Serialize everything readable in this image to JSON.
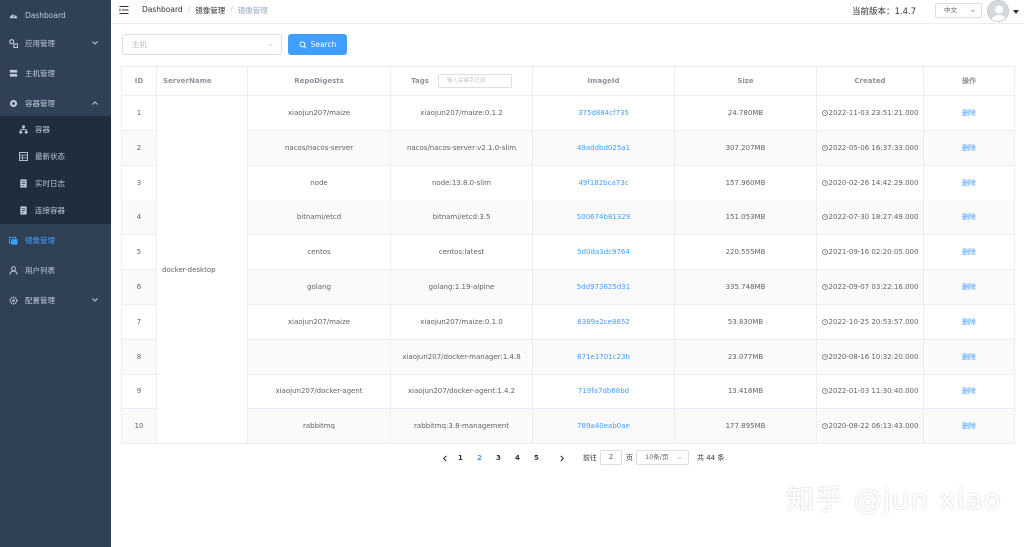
{
  "sidebar": {
    "items": [
      {
        "label": "Dashboard",
        "icon": "dashboard-icon"
      },
      {
        "label": "应用管理",
        "icon": "app-icon"
      },
      {
        "label": "主机管理",
        "icon": "server-icon"
      },
      {
        "label": "容器管理",
        "icon": "container-icon"
      },
      {
        "label": "镜像管理",
        "icon": "image-icon"
      },
      {
        "label": "用户列表",
        "icon": "user-icon"
      },
      {
        "label": "配置管理",
        "icon": "settings-icon"
      }
    ],
    "sub_items": [
      {
        "label": "容器",
        "icon": "tree-icon"
      },
      {
        "label": "最新状态",
        "icon": "table-icon"
      },
      {
        "label": "实时日志",
        "icon": "log-icon"
      },
      {
        "label": "连接容器",
        "icon": "terminal-icon"
      }
    ],
    "active_color": "#409eff",
    "bg_color": "#304156"
  },
  "header": {
    "breadcrumb": [
      "Dashboard",
      "镜像管理",
      "镜像管理"
    ],
    "version": "当前版本：1.4.7",
    "language": "中文"
  },
  "filter": {
    "host_placeholder": "主机",
    "search_label": "Search"
  },
  "table": {
    "columns": {
      "id": "ID",
      "server": "ServerName",
      "repo": "RepoDigests",
      "tags": "Tags",
      "tags_filter_placeholder": "输入关键字过滤",
      "image": "ImageId",
      "size": "Size",
      "created": "Created",
      "ops": "操作"
    },
    "server_name": "docker-desktop",
    "rows": [
      {
        "id": "1",
        "repo": "xiaojun207/maize",
        "tag": "xiaojun207/maize:0.1.2",
        "image": "375d884cf735",
        "size": "24.780MB",
        "created": "2022-11-03 23:51:21.000",
        "op": "删除"
      },
      {
        "id": "2",
        "repo": "nacos/nacos-server",
        "tag": "nacos/nacos-server:v2.1.0-slim",
        "image": "49addbd025a1",
        "size": "307.207MB",
        "created": "2022-05-06 16:37:33.000",
        "op": "删除"
      },
      {
        "id": "3",
        "repo": "node",
        "tag": "node:13.8.0-slim",
        "image": "49f182bca73c",
        "size": "157.960MB",
        "created": "2020-02-26 14:42:29.000",
        "op": "删除"
      },
      {
        "id": "4",
        "repo": "bitnami/etcd",
        "tag": "bitnami/etcd:3.5",
        "image": "500674b81329",
        "size": "151.053MB",
        "created": "2022-07-30 18:27:49.000",
        "op": "删除"
      },
      {
        "id": "5",
        "repo": "centos",
        "tag": "centos:latest",
        "image": "5d0da3dc9764",
        "size": "220.555MB",
        "created": "2021-09-16 02:20:05.000",
        "op": "删除"
      },
      {
        "id": "6",
        "repo": "golang",
        "tag": "golang:1.19-alpine",
        "image": "5dd973625d31",
        "size": "335.748MB",
        "created": "2022-09-07 03:22:16.000",
        "op": "删除"
      },
      {
        "id": "7",
        "repo": "xiaojun207/maize",
        "tag": "xiaojun207/maize:0.1.0",
        "image": "6389a2ce8652",
        "size": "53.830MB",
        "created": "2022-10-25 20:53:57.000",
        "op": "删除"
      },
      {
        "id": "8",
        "repo": "",
        "tag": "xiaojun207/docker-manager:1.4.8",
        "image": "671e1701c23b",
        "size": "23.077MB",
        "created": "2020-08-16 10:32:20.000",
        "op": "删除"
      },
      {
        "id": "9",
        "repo": "xiaojun207/docker-agent",
        "tag": "xiaojun207/docker-agent:1.4.2",
        "image": "719fa7db68bd",
        "size": "13.418MB",
        "created": "2022-01-03 11:30:40.000",
        "op": "删除"
      },
      {
        "id": "10",
        "repo": "rabbitmq",
        "tag": "rabbitmq:3.8-management",
        "image": "789a40eab0ae",
        "size": "177.895MB",
        "created": "2020-08-22 06:13:43.000",
        "op": "删除"
      }
    ]
  },
  "pagination": {
    "pages": [
      "1",
      "2",
      "3",
      "4",
      "5"
    ],
    "current": "2",
    "goto_label": "前往",
    "goto_value": "2",
    "page_unit": "页",
    "page_size": "10条/页",
    "total": "共 44 条"
  },
  "watermark": "知乎 @jun xiao"
}
